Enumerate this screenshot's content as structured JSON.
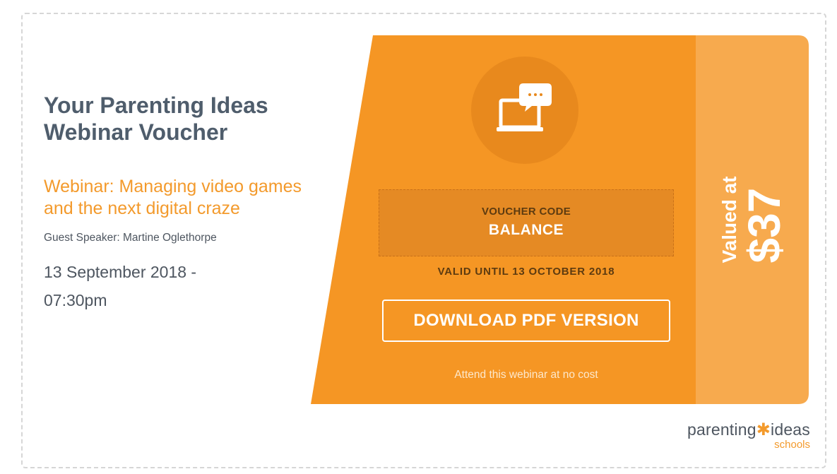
{
  "voucher": {
    "title_line1": "Your Parenting Ideas",
    "title_line2": "Webinar Voucher",
    "webinar_title": "Webinar: Managing video games and the next digital craze",
    "guest_speaker": "Guest Speaker: Martine Oglethorpe",
    "date_line1": "13 September 2018 -",
    "date_line2": "07:30pm"
  },
  "code_panel": {
    "code_label": "VOUCHER CODE",
    "code_value": "BALANCE",
    "valid_until": "VALID UNTIL 13 OCTOBER 2018",
    "download_label": "DOWNLOAD PDF VERSION",
    "note": "Attend this webinar at no cost"
  },
  "value_panel": {
    "valued_label": "Valued at",
    "price": "$37"
  },
  "logo": {
    "word1": "parenting",
    "star": "✱",
    "word2": "ideas",
    "sub": "schools"
  },
  "icons": {
    "webinar": "laptop-chat-icon"
  },
  "colors": {
    "orange": "#f59624",
    "orange_dark": "#e8891d",
    "orange_light": "#f7aa4e",
    "title": "#4f5d6c"
  }
}
